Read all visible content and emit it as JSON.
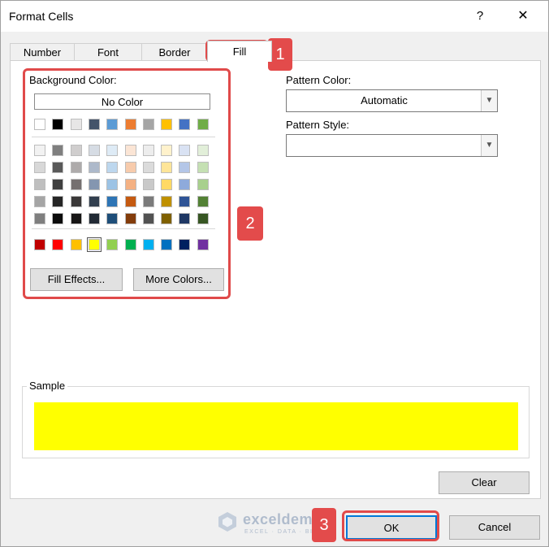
{
  "window": {
    "title": "Format Cells",
    "help_label": "?",
    "close_label": "✕"
  },
  "tabs": [
    {
      "label": "Number"
    },
    {
      "label": "Font"
    },
    {
      "label": "Border"
    },
    {
      "label": "Fill",
      "active": true
    }
  ],
  "fill": {
    "background_color_label": "Background Color:",
    "no_color_label": "No Color",
    "theme_colors_top": [
      "#ffffff",
      "#000000",
      "#e7e6e6",
      "#44546a",
      "#5b9bd5",
      "#ed7d31",
      "#a5a5a5",
      "#ffc000",
      "#4472c4",
      "#70ad47"
    ],
    "tint_rows": [
      [
        "#f2f2f2",
        "#7f7f7f",
        "#d0cece",
        "#d6dce4",
        "#deebf6",
        "#fbe5d5",
        "#ededed",
        "#fff2cc",
        "#d9e2f3",
        "#e2efd9"
      ],
      [
        "#d8d8d8",
        "#595959",
        "#aeabab",
        "#adb9ca",
        "#bdd7ee",
        "#f7cbac",
        "#dbdbdb",
        "#fee599",
        "#b4c6e7",
        "#c5e0b3"
      ],
      [
        "#bfbfbf",
        "#3f3f3f",
        "#757070",
        "#8496b0",
        "#9cc3e5",
        "#f4b183",
        "#c9c9c9",
        "#ffd965",
        "#8eaadb",
        "#a8d08d"
      ],
      [
        "#a5a5a5",
        "#262626",
        "#3a3838",
        "#323f4f",
        "#2e75b5",
        "#c55a11",
        "#7b7b7b",
        "#bf9000",
        "#2f5496",
        "#538135"
      ],
      [
        "#7f7f7f",
        "#0c0c0c",
        "#171616",
        "#222a35",
        "#1e4e79",
        "#833c0b",
        "#525252",
        "#7f6000",
        "#1f3864",
        "#375623"
      ]
    ],
    "standard_colors": [
      "#c00000",
      "#ff0000",
      "#ffc000",
      "#ffff00",
      "#92d050",
      "#00b050",
      "#00b0f0",
      "#0070c0",
      "#002060",
      "#7030a0"
    ],
    "selected_standard_index": 3,
    "fill_effects_label": "Fill Effects...",
    "more_colors_label": "More Colors...",
    "pattern_color_label": "Pattern Color:",
    "pattern_color_value": "Automatic",
    "pattern_style_label": "Pattern Style:",
    "pattern_style_value": ""
  },
  "sample": {
    "label": "Sample",
    "color": "#ffff00"
  },
  "buttons": {
    "clear_label": "Clear",
    "ok_label": "OK",
    "cancel_label": "Cancel"
  },
  "annotations": {
    "badge1": "1",
    "badge2": "2",
    "badge3": "3",
    "accent_color": "#e34b4b"
  },
  "watermark": {
    "name": "exceldemy",
    "tagline": "EXCEL · DATA · BI"
  }
}
